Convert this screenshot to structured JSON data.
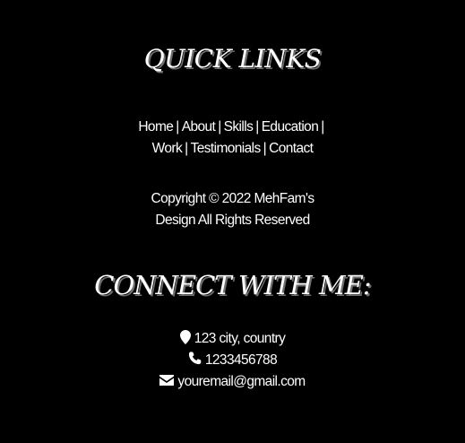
{
  "quick_links": {
    "heading": "QUICK LINKS",
    "items": [
      {
        "label": "Home"
      },
      {
        "label": "About"
      },
      {
        "label": "Skills"
      },
      {
        "label": "Education"
      },
      {
        "label": "Work"
      },
      {
        "label": "Testimonials"
      },
      {
        "label": "Contact"
      }
    ],
    "separator": "|"
  },
  "copyright": {
    "line1": "Copyright © 2022 MehFam's",
    "line2": "Design All Rights Reserved"
  },
  "connect": {
    "heading": "CONNECT WITH ME:",
    "address": {
      "text": "123 city, country",
      "icon": "map-marker-icon"
    },
    "phone": {
      "text": "1233456788",
      "icon": "phone-icon"
    },
    "email": {
      "text": "youremail@gmail.com",
      "icon": "envelope-icon"
    }
  },
  "colors": {
    "background": "#000000",
    "text": "#ffffff",
    "heading_shadow": "#6e6e6e"
  }
}
